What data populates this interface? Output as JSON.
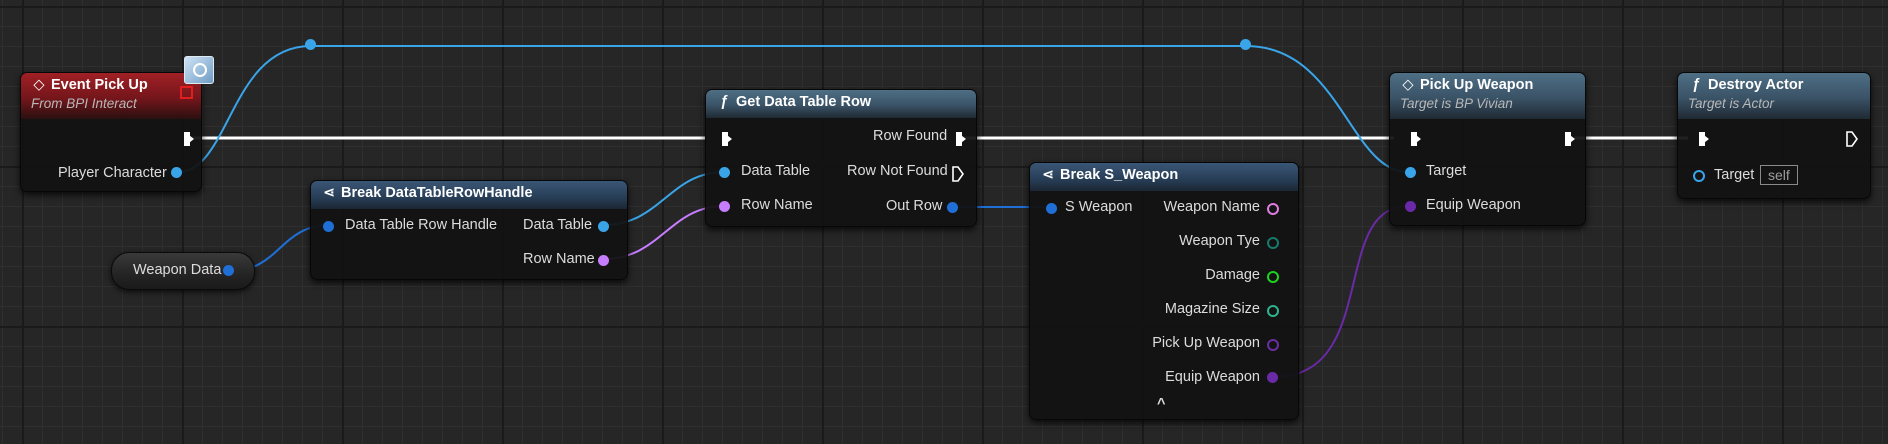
{
  "colors": {
    "exec": "#ffffff",
    "object": "#3aa4e8",
    "struct_handle": "#1f6fd6",
    "name": "#c77dff",
    "struct": "#1f6fd6",
    "text": "#e07de0",
    "byte": "#177a6a",
    "int": "#1ed31e",
    "float": "#2fb28e",
    "asset": "#6a2ea0",
    "equip": "#6a2aa8"
  },
  "event_node": {
    "title": "Event Pick Up",
    "subtitle": "From BPI Interact",
    "icon": "diamond-icon",
    "pin_player_character": "Player Character"
  },
  "variable_node": {
    "label": "Weapon Data"
  },
  "break_handle_node": {
    "title": "Break DataTableRowHandle",
    "icon": "break-struct-icon",
    "pin_handle": "Data Table Row Handle",
    "pin_data_table": "Data Table",
    "pin_row_name": "Row Name"
  },
  "get_row_node": {
    "title": "Get Data Table Row",
    "icon": "function-icon",
    "pin_row_found": "Row Found",
    "pin_row_not_found": "Row Not Found",
    "pin_data_table": "Data Table",
    "pin_row_name": "Row Name",
    "pin_out_row": "Out Row"
  },
  "break_weapon_node": {
    "title": "Break S_Weapon",
    "icon": "break-struct-icon",
    "pin_s_weapon": "S Weapon",
    "outputs": [
      "Weapon Name",
      "Weapon Tye",
      "Damage",
      "Magazine Size",
      "Pick Up Weapon",
      "Equip Weapon"
    ],
    "collapse_glyph": "^"
  },
  "pickup_node": {
    "title": "Pick Up Weapon",
    "subtitle": "Target is BP Vivian",
    "icon": "diamond-icon",
    "pin_target": "Target",
    "pin_equip": "Equip Weapon"
  },
  "destroy_node": {
    "title": "Destroy Actor",
    "subtitle": "Target is Actor",
    "icon": "function-icon",
    "pin_target": "Target",
    "self_value": "self"
  }
}
